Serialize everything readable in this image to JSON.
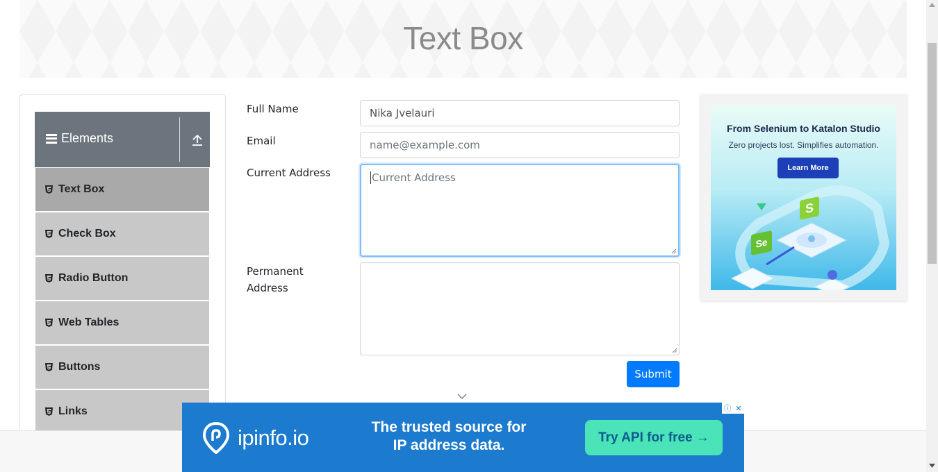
{
  "page": {
    "title": "Text Box"
  },
  "sidebar": {
    "group_title": "Elements",
    "items": [
      {
        "label": "Text Box",
        "active": true
      },
      {
        "label": "Check Box",
        "active": false
      },
      {
        "label": "Radio Button",
        "active": false
      },
      {
        "label": "Web Tables",
        "active": false
      },
      {
        "label": "Buttons",
        "active": false
      },
      {
        "label": "Links",
        "active": false
      }
    ]
  },
  "form": {
    "full_name": {
      "label": "Full Name",
      "value": "Nika Jvelauri",
      "placeholder": ""
    },
    "email": {
      "label": "Email",
      "value": "",
      "placeholder": "name@example.com"
    },
    "current_address": {
      "label": "Current Address",
      "value": "",
      "placeholder": "Current Address",
      "focused": true
    },
    "permanent_address": {
      "label_line1": "Permanent",
      "label_line2": "Address",
      "value": ""
    },
    "submit_label": "Submit"
  },
  "side_ad": {
    "title": "From Selenium to Katalon Studio",
    "subtitle": "Zero projects lost. Simplifies automation.",
    "button": "Learn More",
    "logo_letter_1": "S",
    "logo_letter_2": "Se"
  },
  "bottom_ad": {
    "brand": "ipinfo.io",
    "tagline_line1": "The trusted source for",
    "tagline_line2": "IP address data.",
    "cta": "Try API for free →"
  },
  "colors": {
    "primary": "#007bff",
    "sidebar_header": "#6c757d",
    "menu_item": "#c8c8c8",
    "menu_item_active": "#a9a9a9",
    "ad_blue": "#1c7bcf",
    "ad_cta": "#4be3b8"
  },
  "icons": [
    "hamburger-icon",
    "upload-icon",
    "html5-icon",
    "chevron-down-icon",
    "location-pin-icon",
    "adchoices-icon",
    "close-icon"
  ]
}
